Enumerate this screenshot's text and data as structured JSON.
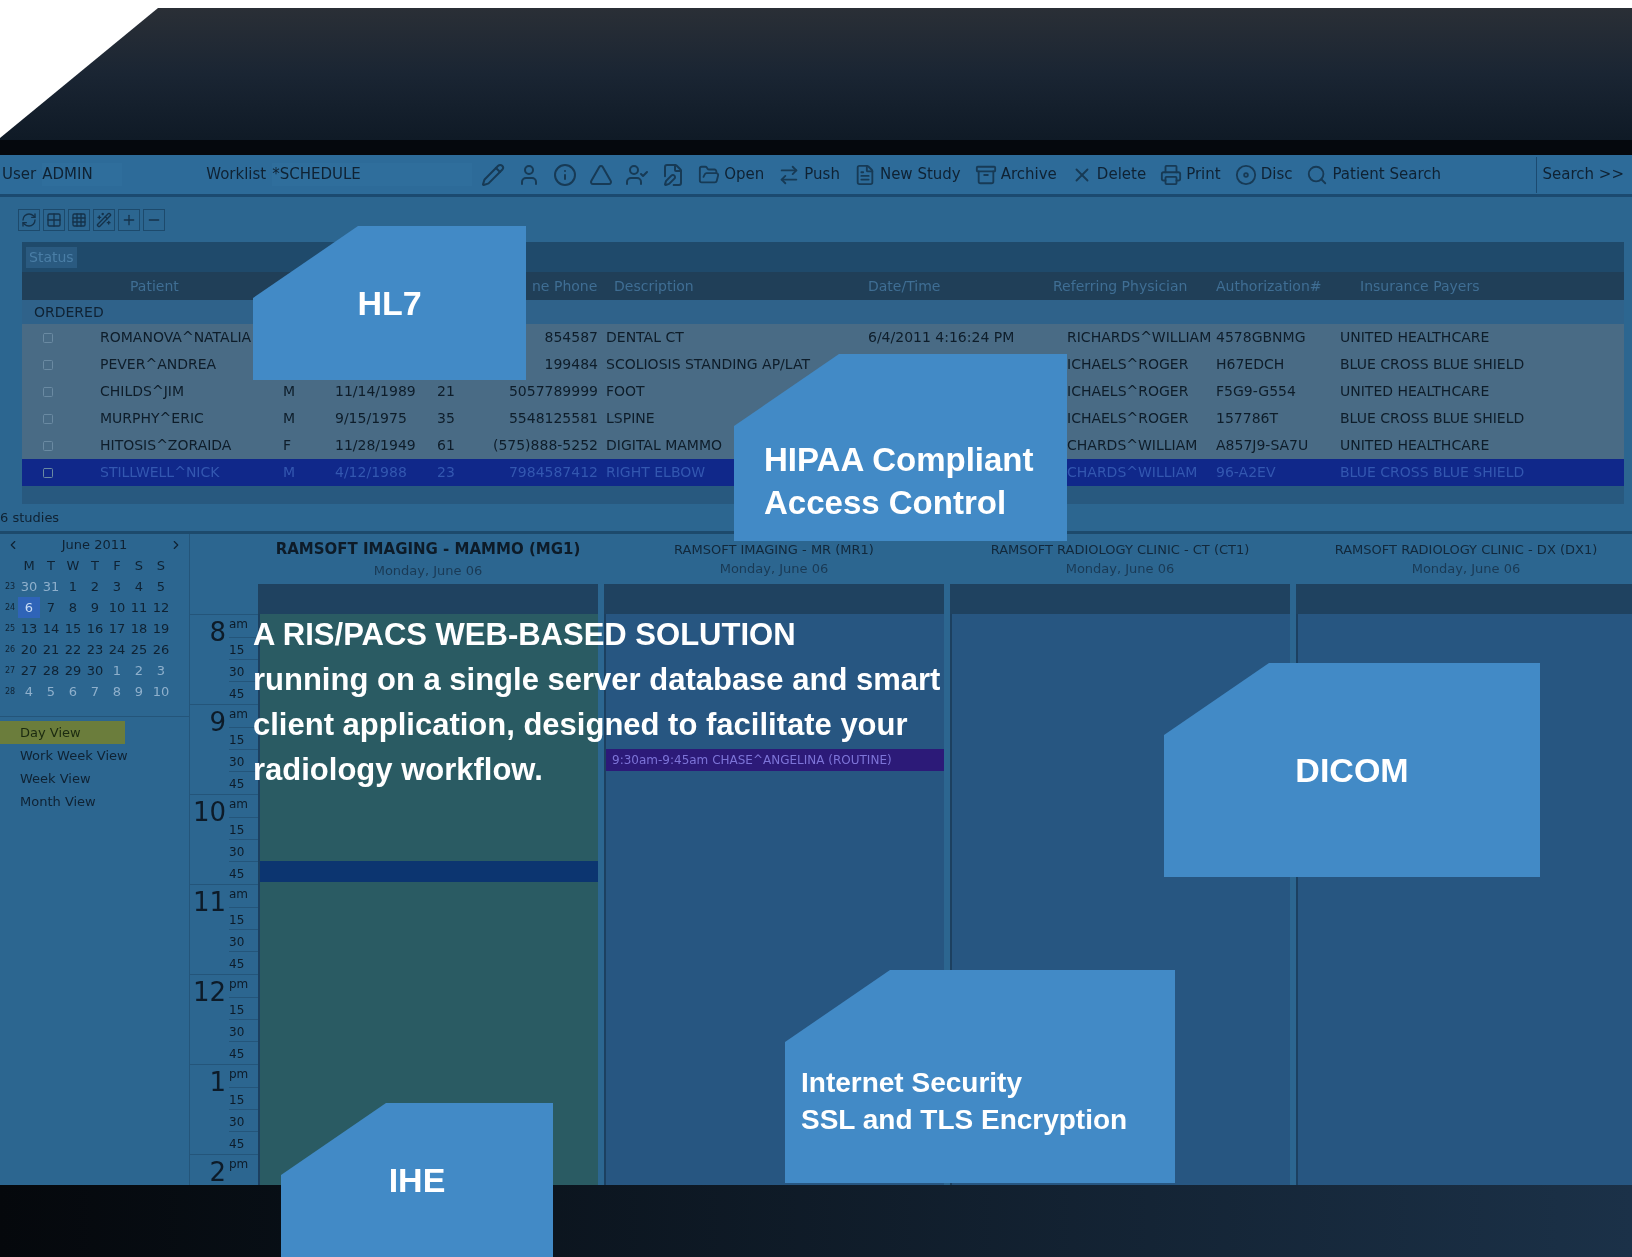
{
  "toolbar": {
    "user_label": "User",
    "user": "ADMIN",
    "worklist_label": "Worklist",
    "worklist": "*SCHEDULE",
    "buttons": [
      {
        "label": "Open"
      },
      {
        "label": "Push"
      },
      {
        "label": "New Study"
      },
      {
        "label": "Archive"
      },
      {
        "label": "Delete"
      },
      {
        "label": "Print"
      },
      {
        "label": "Disc"
      },
      {
        "label": "Patient Search"
      }
    ],
    "search_button": "Search >>"
  },
  "status_filter": "Status",
  "table": {
    "columns": {
      "patient": "Patient",
      "phone": "ne Phone",
      "description": "Description",
      "date": "Date/Time",
      "physician": "Referring Physician",
      "authorization": "Authorization#",
      "insurance": "Insurance Payers"
    },
    "group": "ORDERED",
    "rows": [
      {
        "patient": "ROMANOVA^NATALIA",
        "phone": "854587",
        "description": "DENTAL CT",
        "date": "6/4/2011 4:16:24 PM",
        "physician": "RICHARDS^WILLIAM",
        "authorization": "4578GBNMG",
        "insurance": "UNITED HEALTHCARE",
        "selected": false
      },
      {
        "patient": "PEVER^ANDREA",
        "phone": "199484",
        "description": "SCOLIOSIS STANDING AP/LAT",
        "physician": "ICHAELS^ROGER",
        "authorization": "H67EDCH",
        "insurance": "BLUE CROSS BLUE SHIELD",
        "selected": false
      },
      {
        "patient": "CHILDS^JIM",
        "sex": "M",
        "dob": "11/14/1989",
        "age": "21",
        "phone": "5057789999",
        "description": "FOOT",
        "physician": "ICHAELS^ROGER",
        "authorization": "F5G9-G554",
        "insurance": "UNITED HEALTHCARE",
        "selected": false
      },
      {
        "patient": "MURPHY^ERIC",
        "sex": "M",
        "dob": "9/15/1975",
        "age": "35",
        "phone": "5548125581",
        "description": "LSPINE",
        "physician": "ICHAELS^ROGER",
        "authorization": "157786T",
        "insurance": "BLUE CROSS BLUE SHIELD",
        "selected": false
      },
      {
        "patient": "HITOSIS^ZORAIDA",
        "sex": "F",
        "dob": "11/28/1949",
        "age": "61",
        "phone": "(575)888-5252",
        "description": "DIGITAL MAMMO",
        "physician": "CHARDS^WILLIAM",
        "authorization": "A857J9-SA7U",
        "insurance": "UNITED HEALTHCARE",
        "selected": false
      },
      {
        "patient": "STILLWELL^NICK",
        "sex": "M",
        "dob": "4/12/1988",
        "age": "23",
        "phone": "7984587412",
        "description": "RIGHT ELBOW",
        "physician": "CHARDS^WILLIAM",
        "authorization": "96-A2EV",
        "insurance": "BLUE CROSS BLUE SHIELD",
        "selected": true
      }
    ],
    "footer": "6 studies"
  },
  "calendar": {
    "month": "June 2011",
    "weekdays": [
      "M",
      "T",
      "W",
      "T",
      "F",
      "S",
      "S"
    ],
    "weeks": [
      {
        "number": "23",
        "days": [
          {
            "day": "30",
            "muted": true,
            "selected": false
          },
          {
            "day": "31",
            "muted": true,
            "selected": false
          },
          {
            "day": "1",
            "muted": false,
            "selected": false
          },
          {
            "day": "2",
            "muted": false,
            "selected": false
          },
          {
            "day": "3",
            "muted": false,
            "selected": false
          },
          {
            "day": "4",
            "muted": false,
            "selected": false
          },
          {
            "day": "5",
            "muted": false,
            "selected": false
          }
        ]
      },
      {
        "number": "24",
        "days": [
          {
            "day": "6",
            "muted": false,
            "selected": true
          },
          {
            "day": "7",
            "muted": false,
            "selected": false
          },
          {
            "day": "8",
            "muted": false,
            "selected": false
          },
          {
            "day": "9",
            "muted": false,
            "selected": false
          },
          {
            "day": "10",
            "muted": false,
            "selected": false
          },
          {
            "day": "11",
            "muted": false,
            "selected": false
          },
          {
            "day": "12",
            "muted": false,
            "selected": false
          }
        ]
      },
      {
        "number": "25",
        "days": [
          {
            "day": "13",
            "muted": false,
            "selected": false
          },
          {
            "day": "14",
            "muted": false,
            "selected": false
          },
          {
            "day": "15",
            "muted": false,
            "selected": false
          },
          {
            "day": "16",
            "muted": false,
            "selected": false
          },
          {
            "day": "17",
            "muted": false,
            "selected": false
          },
          {
            "day": "18",
            "muted": false,
            "selected": false
          },
          {
            "day": "19",
            "muted": false,
            "selected": false
          }
        ]
      },
      {
        "number": "26",
        "days": [
          {
            "day": "20",
            "muted": false,
            "selected": false
          },
          {
            "day": "21",
            "muted": false,
            "selected": false
          },
          {
            "day": "22",
            "muted": false,
            "selected": false
          },
          {
            "day": "23",
            "muted": false,
            "selected": false
          },
          {
            "day": "24",
            "muted": false,
            "selected": false
          },
          {
            "day": "25",
            "muted": false,
            "selected": false
          },
          {
            "day": "26",
            "muted": false,
            "selected": false
          }
        ]
      },
      {
        "number": "27",
        "days": [
          {
            "day": "27",
            "muted": false,
            "selected": false
          },
          {
            "day": "28",
            "muted": false,
            "selected": false
          },
          {
            "day": "29",
            "muted": false,
            "selected": false
          },
          {
            "day": "30",
            "muted": false,
            "selected": false
          },
          {
            "day": "1",
            "muted": true,
            "selected": false
          },
          {
            "day": "2",
            "muted": true,
            "selected": false
          },
          {
            "day": "3",
            "muted": true,
            "selected": false
          }
        ]
      },
      {
        "number": "28",
        "days": [
          {
            "day": "4",
            "muted": true,
            "selected": false
          },
          {
            "day": "5",
            "muted": true,
            "selected": false
          },
          {
            "day": "6",
            "muted": true,
            "selected": false
          },
          {
            "day": "7",
            "muted": true,
            "selected": false
          },
          {
            "day": "8",
            "muted": true,
            "selected": false
          },
          {
            "day": "9",
            "muted": true,
            "selected": false
          },
          {
            "day": "10",
            "muted": true,
            "selected": false
          }
        ]
      }
    ]
  },
  "views": [
    {
      "label": "Day View",
      "selected": true
    },
    {
      "label": "Work Week View",
      "selected": false
    },
    {
      "label": "Week View",
      "selected": false
    },
    {
      "label": "Month View",
      "selected": false
    }
  ],
  "hours": [
    {
      "hour": "8",
      "period": "am",
      "marks": [
        "15",
        "30",
        "45"
      ]
    },
    {
      "hour": "9",
      "period": "am",
      "marks": [
        "15",
        "30",
        "45"
      ]
    },
    {
      "hour": "10",
      "period": "am",
      "marks": [
        "15",
        "30",
        "45"
      ]
    },
    {
      "hour": "11",
      "period": "am",
      "marks": [
        "15",
        "30",
        "45"
      ]
    },
    {
      "hour": "12",
      "period": "pm",
      "marks": [
        "15",
        "30",
        "45"
      ]
    },
    {
      "hour": "1",
      "period": "pm",
      "marks": [
        "15",
        "30",
        "45"
      ]
    },
    {
      "hour": "2",
      "period": "pm"
    }
  ],
  "resources": [
    {
      "name": "RAMSOFT IMAGING - MAMMO (MG1)",
      "date": "Monday, June 06",
      "selected": true
    },
    {
      "name": "RAMSOFT IMAGING - MR (MR1)",
      "date": "Monday, June 06",
      "selected": false,
      "appointment": "9:30am-9:45am CHASE^ANGELINA (ROUTINE)"
    },
    {
      "name": "RAMSOFT RADIOLOGY CLINIC - CT (CT1)",
      "date": "Monday, June 06",
      "selected": false
    },
    {
      "name": "RAMSOFT RADIOLOGY CLINIC - DX (DX1)",
      "date": "Monday, June 06",
      "selected": false
    }
  ],
  "headline": {
    "title": "A RIS/PACS WEB-BASED SOLUTION",
    "lines": [
      "running on a single server database and smart",
      "client application, designed to facilitate your",
      "radiology workflow."
    ]
  },
  "callouts": [
    {
      "lines": [
        "HL7"
      ]
    },
    {
      "lines": [
        "HIPAA Compliant",
        "Access Control"
      ]
    },
    {
      "lines": [
        "DICOM"
      ]
    },
    {
      "lines": [
        "Internet Security",
        "SSL and TLS Encryption"
      ]
    },
    {
      "lines": [
        "IHE"
      ]
    }
  ]
}
